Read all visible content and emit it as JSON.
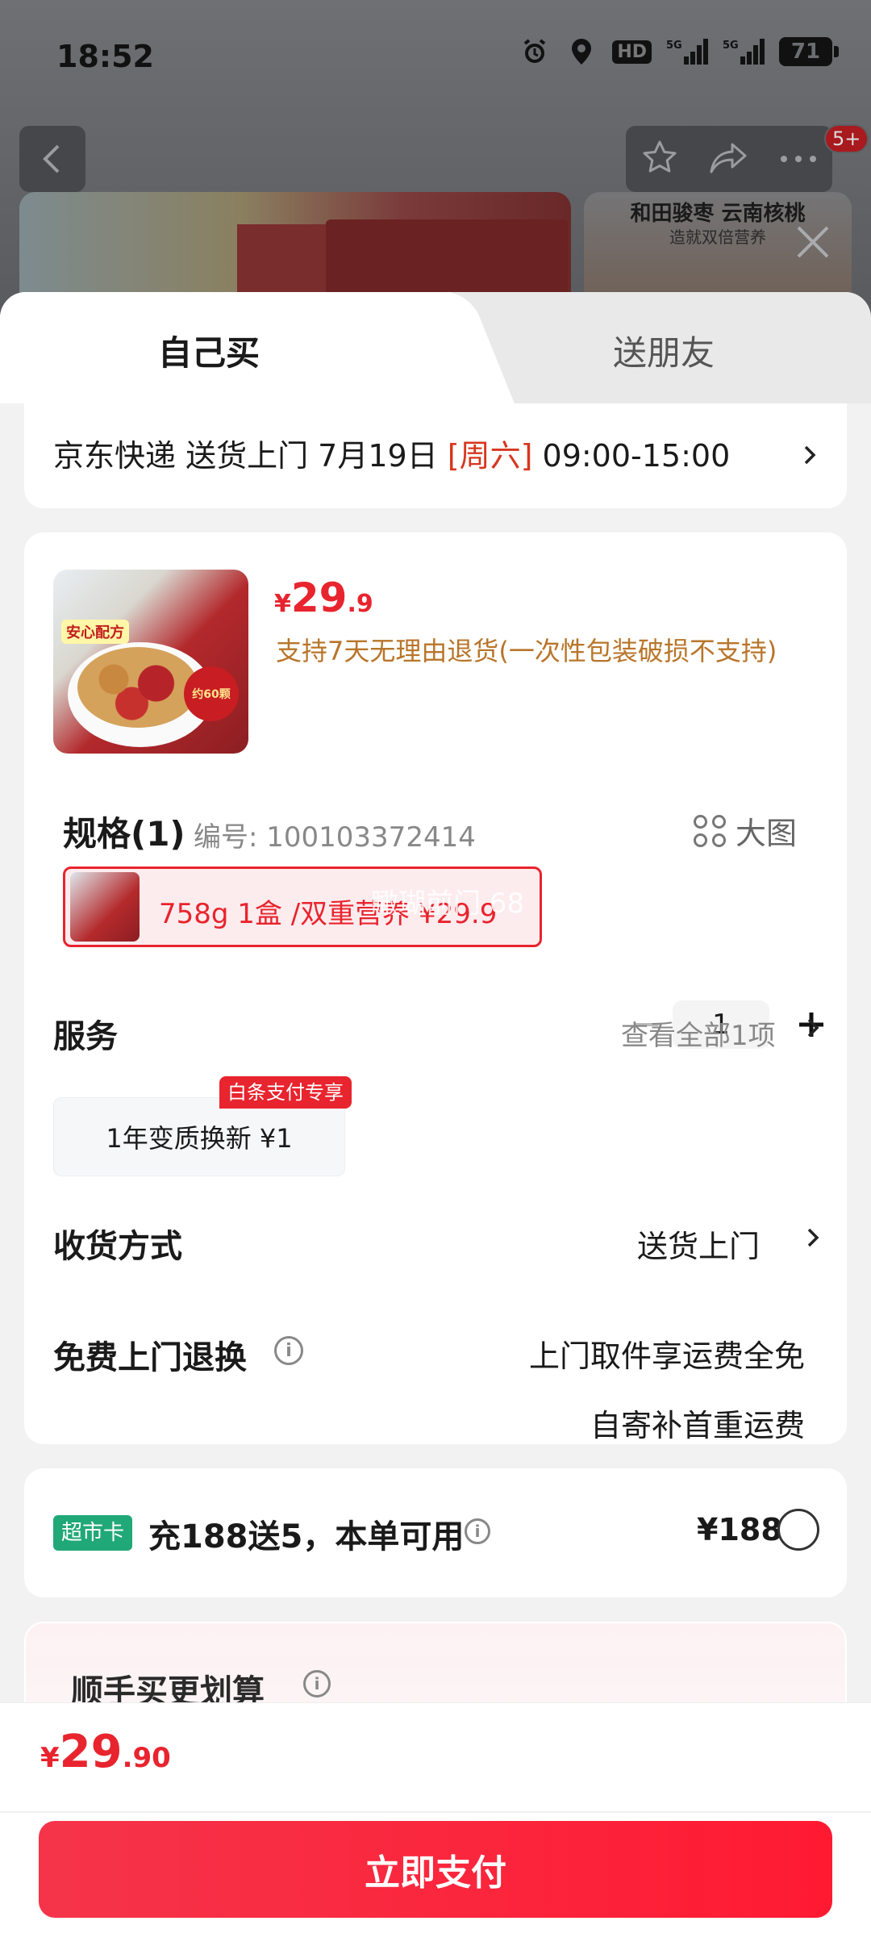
{
  "status_bar": {
    "time": "18:52",
    "hd": "HD",
    "net1": "5G",
    "net2": "5G",
    "battery": "71"
  },
  "banner": {
    "side_title": "和田骏枣 云南核桃",
    "side_subtitle": "造就双倍营养",
    "notification_badge": "5+"
  },
  "tabs": {
    "self": "自己买",
    "gift": "送朋友"
  },
  "delivery": {
    "prefix": "京东快递 送货上门 7月19日 ",
    "weekday": "[周六]",
    "time": " 09:00-15:00"
  },
  "product": {
    "currency": "¥",
    "price_int": "29",
    "price_dec": ".9",
    "return_policy": "支持7天无理由退货(一次性包装破损不支持)",
    "image_tag": "安心配方",
    "image_seal": "约60颗",
    "quantity": "1"
  },
  "spec": {
    "title": "规格(1)",
    "sku": "编号: 100103372414",
    "big_image": "大图",
    "option_label": "758g 1盒 /双重营养 ¥29.9",
    "watermark": "瞰瑚前门 68"
  },
  "service": {
    "title": "服务",
    "more": "查看全部1项",
    "chip": "1年变质换新 ¥1",
    "chip_tag": "白条支付专享"
  },
  "shipping": {
    "title": "收货方式",
    "value": "送货上门"
  },
  "free_return": {
    "title": "免费上门退换",
    "line1": "上门取件享运费全免",
    "line2": "自寄补首重运费"
  },
  "member": {
    "tag": "超市卡",
    "text": "充188送5，本单可用",
    "price": "¥188"
  },
  "addon": {
    "title": "顺手买更划算"
  },
  "footer": {
    "currency": "¥",
    "total_int": "29",
    "total_dec": ".90",
    "pay_label": "立即支付"
  },
  "colors": {
    "accent_red": "#e8242e",
    "policy_gold": "#b8752a",
    "member_green": "#21a878"
  }
}
